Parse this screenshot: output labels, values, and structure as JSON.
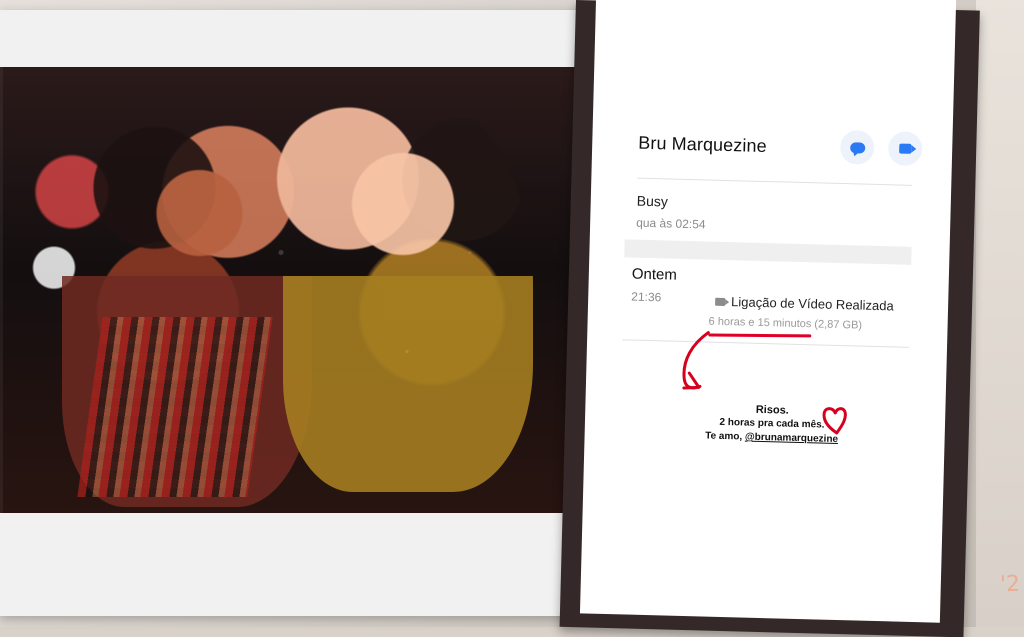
{
  "phone_ui": {
    "contact_name": "Bru Marquezine",
    "status": {
      "title": "Busy",
      "time": "qua às 02:54"
    },
    "call_log": {
      "day": "Ontem",
      "time": "21:36",
      "type": "Ligação de Vídeo Realizada",
      "details": "6 horas e 15 minutos (2,87 GB)"
    }
  },
  "note": {
    "line_1": "Risos.",
    "line_2": "2 horas pra cada mês.",
    "line_3_prefix": "Te amo, ",
    "mention": "@brunamarquezine"
  },
  "decorations": {
    "faint_date": "'2"
  },
  "icons": {
    "message": "message-icon",
    "video": "video-camera-icon",
    "call_video": "video-call-icon",
    "arrow": "red-arrow-icon",
    "heart": "red-heart-icon"
  },
  "colors": {
    "accent_blue": "#2a7af5",
    "highlight_red": "#d7001f",
    "phone_frame": "#342828"
  }
}
